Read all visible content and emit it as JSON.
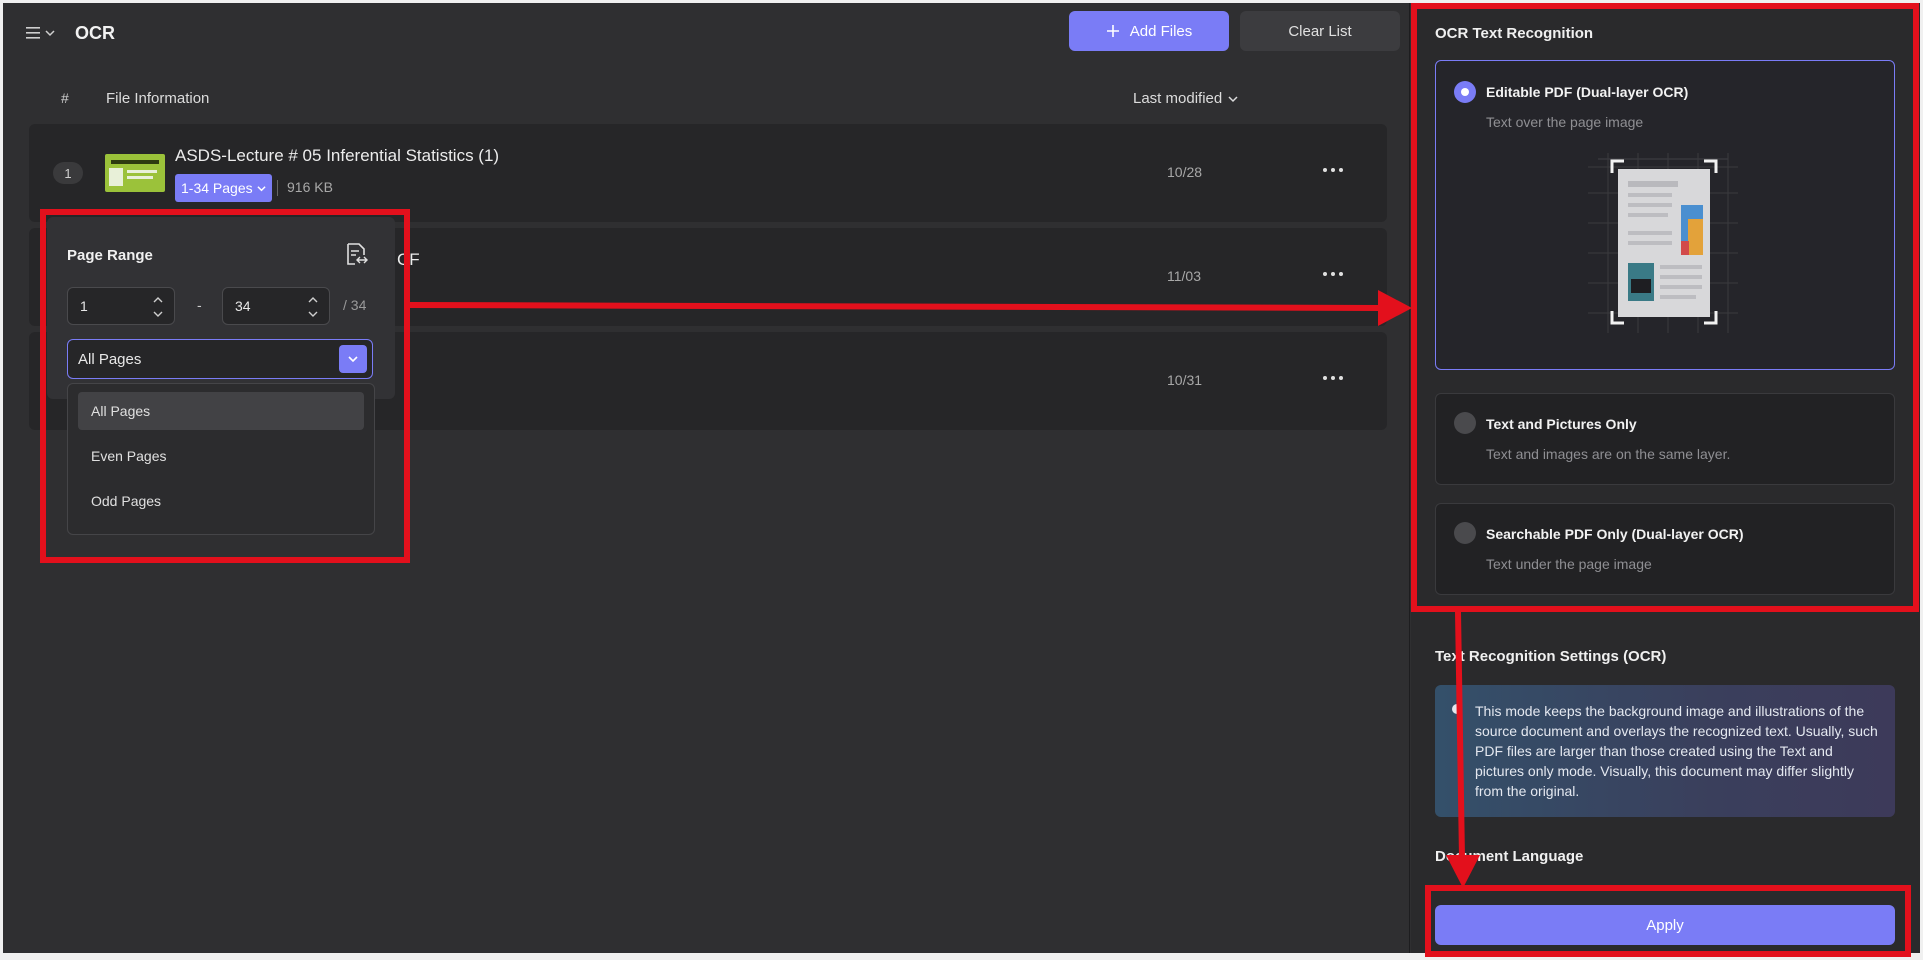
{
  "header": {
    "title": "OCR",
    "add_files_label": "Add Files",
    "clear_list_label": "Clear List"
  },
  "table": {
    "col_number": "#",
    "col_info": "File Information",
    "col_modified": "Last modified",
    "rows": [
      {
        "num": "1",
        "name": "ASDS-Lecture # 05 Inferential Statistics (1)",
        "pages": "1-34 Pages",
        "size": "916 KB",
        "date": "10/28"
      },
      {
        "name_peek": "CF",
        "date": "11/03"
      },
      {
        "date": "10/31"
      }
    ]
  },
  "page_range": {
    "title": "Page Range",
    "from": "1",
    "to": "34",
    "dash": "-",
    "total": "/ 34",
    "selected": "All Pages",
    "options": [
      "All Pages",
      "Even Pages",
      "Odd Pages"
    ]
  },
  "side": {
    "title": "OCR Text Recognition",
    "options": [
      {
        "title": "Editable PDF (Dual-layer OCR)",
        "desc": "Text over the page image",
        "selected": true
      },
      {
        "title": "Text and Pictures Only",
        "desc": "Text and images are on the same layer.",
        "selected": false
      },
      {
        "title": "Searchable PDF Only (Dual-layer OCR)",
        "desc": "Text under the page image",
        "selected": false
      }
    ],
    "settings_title": "Text Recognition Settings (OCR)",
    "settings_info": "This mode keeps the background image and illustrations of the source document and overlays the recognized text. Usually, such PDF files are larger than those created using the Text and pictures only mode. Visually, this document may differ slightly from the original.",
    "language_title": "Document Language",
    "apply_label": "Apply"
  },
  "colors": {
    "accent": "#7a7cf6",
    "annotation": "#e3101c",
    "background": "#2f2f31"
  }
}
